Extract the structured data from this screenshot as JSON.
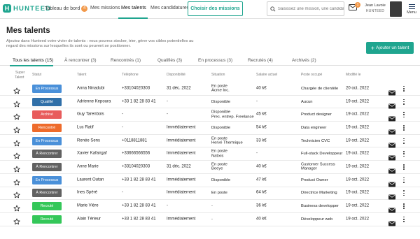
{
  "app": {
    "logo_letter": "H",
    "logo_text": "HUNTEED"
  },
  "nav": {
    "items": [
      {
        "label": "Tableau de bord",
        "badge": "4"
      },
      {
        "label": "Mes missions"
      },
      {
        "label": "Mes talents"
      },
      {
        "label": "Mes candidatures"
      }
    ],
    "choose_button": "Choisir des missions"
  },
  "search": {
    "placeholder": "Saisissez une mission, une candidature..."
  },
  "notifications": {
    "count": "1"
  },
  "user": {
    "name": "Jean Lavoie",
    "company": "HUNTEED"
  },
  "menu": {
    "label": "Menu"
  },
  "page": {
    "title": "Mes talents",
    "description": "Ajoutez dans Hunteed votre vivier de talents : vous pourrez stocker, trier, gérer vos cibles potentielles au regard des missions sur lesquelles ils sont ou peuvent se positionner.",
    "add_button": "Ajouter un talent"
  },
  "tabs": [
    {
      "label": "Tous les talents",
      "count": "(15)"
    },
    {
      "label": "À rencontrer",
      "count": "(3)"
    },
    {
      "label": "Rencontrés",
      "count": "(1)"
    },
    {
      "label": "Qualifiés",
      "count": "(3)"
    },
    {
      "label": "En processus",
      "count": "(3)"
    },
    {
      "label": "Recrutés",
      "count": "(4)"
    },
    {
      "label": "Archivés",
      "count": "(2)"
    }
  ],
  "table": {
    "headers": {
      "super": "Super",
      "talent": "Talent",
      "status": "Statut",
      "talent_col": "Talent",
      "phone": "Téléphone",
      "availability": "Disponibilité",
      "situation": "Situation",
      "salary": "Salaire actuel",
      "position": "Poste occupé",
      "modified": "Modifié le"
    },
    "status_colors": {
      "En Processus": "#4a90d9",
      "Qualifié": "#2f6fa8",
      "Archivé": "#e85c5c",
      "Rencontré": "#ee6b2b",
      "À Rencontrer": "#616161",
      "Recruté": "#34c759"
    },
    "rows": [
      {
        "status": "En Processus",
        "name": "Anna Ninadubi",
        "phone": "+33104020303",
        "availability": "31 déc. 2022",
        "situation": [
          "En poste",
          "Acme Inc."
        ],
        "salary": "40 k€",
        "position": [
          "Chargée de clientèle"
        ],
        "modified": "20 oct. 2022"
      },
      {
        "status": "Qualifié",
        "name": "Adrienne Kepoura",
        "phone": "+33 1 82 28 83 41",
        "availability": "-",
        "situation": [
          "Disponible"
        ],
        "salary": "-",
        "position": [
          "Aucun"
        ],
        "modified": "19 oct. 2022"
      },
      {
        "status": "Archivé",
        "name": "Guy Tarenbois",
        "phone": "-",
        "availability": "-",
        "situation": [
          "Disponible",
          "Prec. entrep. Freelance"
        ],
        "salary": "45 k€",
        "position": [
          "Product designer"
        ],
        "modified": "19 oct. 2022"
      },
      {
        "status": "Rencontré",
        "name": "Luc Ratif",
        "phone": "-",
        "availability": "Immédiatement",
        "situation": [
          "Disponible"
        ],
        "salary": "54 k€",
        "position": [
          "Data engineer"
        ],
        "modified": "19 oct. 2022"
      },
      {
        "status": "En Processus",
        "name": "Renée Sens",
        "phone": "+0118811881",
        "availability": "Immédiatement",
        "situation": [
          "En poste",
          "Hervé Thermique"
        ],
        "salary": "33 k€",
        "position": [
          "Technicien CVC"
        ],
        "modified": "19 oct. 2022"
      },
      {
        "status": "À Rencontrer",
        "name": "Xavier Kafairgaf",
        "phone": "+33666566556",
        "availability": "Immédiatement",
        "situation": [
          "En poste",
          "Natixis"
        ],
        "salary": "-",
        "position": [
          "Full-stack Developpeur"
        ],
        "modified": "19 oct. 2022"
      },
      {
        "status": "À Rencontrer",
        "name": "Anne Marie",
        "phone": "+33104020303",
        "availability": "31 déc. 2022",
        "situation": [
          "En poste",
          "Beeye"
        ],
        "salary": "40 k€",
        "position": [
          "Customer Success",
          "Manager"
        ],
        "modified": "19 oct. 2022"
      },
      {
        "status": "En Processus",
        "name": "Laurent Outan",
        "phone": "+33 1 82 28 83 41",
        "availability": "Immédiatement",
        "situation": [
          "Disponible"
        ],
        "salary": "47 k€",
        "position": [
          "Product Owner"
        ],
        "modified": "19 oct. 2022"
      },
      {
        "status": "À Rencontrer",
        "name": "Ines Spéré",
        "phone": "-",
        "availability": "Immédiatement",
        "situation": [
          "En poste"
        ],
        "salary": "64 k€",
        "position": [
          "Directrice Marketing"
        ],
        "modified": "19 oct. 2022"
      },
      {
        "status": "Recruté",
        "name": "Marie Vière",
        "phone": "+33 1 82 28 83 41",
        "availability": "-",
        "situation": [
          "-"
        ],
        "salary": "36 k€",
        "position": [
          "Business developper"
        ],
        "modified": "19 oct. 2022"
      },
      {
        "status": "Recruté",
        "name": "Alain Térieur",
        "phone": "+33 1 82 28 83 41",
        "availability": "Immédiatement",
        "situation": [
          "-"
        ],
        "salary": "40 k€",
        "position": [
          "Développeur web"
        ],
        "modified": "19 oct. 2022"
      }
    ]
  }
}
